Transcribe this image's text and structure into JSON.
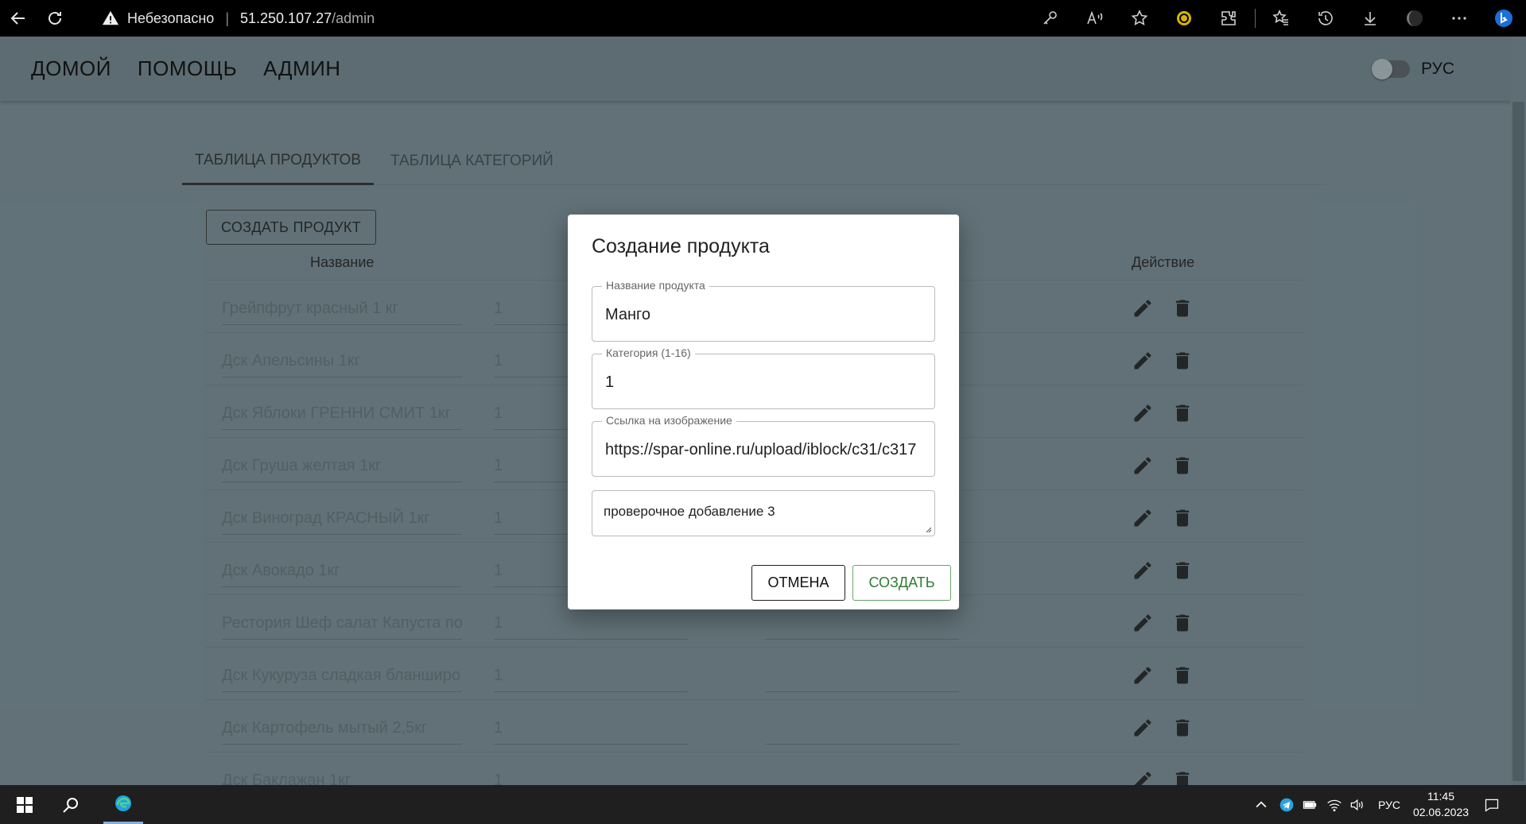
{
  "browser": {
    "security_label": "Небезопасно",
    "host": "51.250.107.27",
    "path": "/admin"
  },
  "app": {
    "nav": [
      "ДОМОЙ",
      "ПОМОЩЬ",
      "АДМИН"
    ],
    "language": "РУС"
  },
  "tabs": [
    "ТАБЛИЦА ПРОДУКТОВ",
    "ТАБЛИЦА КАТЕГОРИЙ"
  ],
  "create_button": "СОЗДАТЬ ПРОДУКТ",
  "table": {
    "headers": {
      "name": "Название",
      "action": "Действие"
    },
    "rows": [
      {
        "name": "Грейпфрут красный 1 кг",
        "category": "1"
      },
      {
        "name": "Дск Апельсины 1кг",
        "category": "1"
      },
      {
        "name": "Дск Яблоки ГРЕННИ СМИТ 1кг",
        "category": "1"
      },
      {
        "name": "Дск Груша желтая 1кг",
        "category": "1"
      },
      {
        "name": "Дск Виноград КРАСНЫЙ 1кг",
        "category": "1"
      },
      {
        "name": "Дск Авокадо 1кг",
        "category": "1"
      },
      {
        "name": "Рестория Шеф салат Капуста по",
        "category": "1"
      },
      {
        "name": "Дск Кукуруза сладкая бланширо",
        "category": "1"
      },
      {
        "name": "Дск Картофель мытый 2,5кг",
        "category": "1"
      },
      {
        "name": "Дск Баклажан 1кг",
        "category": "1"
      }
    ]
  },
  "modal": {
    "title": "Создание продукта",
    "fields": {
      "name_label": "Название продукта",
      "name_value": "Манго",
      "category_label": "Категория (1-16)",
      "category_value": "1",
      "image_label": "Ссылка на изображение",
      "image_value": "https://spar-online.ru/upload/iblock/c31/c317",
      "description_value": "проверочное добавление 3"
    },
    "cancel": "ОТМЕНА",
    "create": "СОЗДАТЬ"
  },
  "taskbar": {
    "tray_language": "РУС",
    "time": "11:45",
    "date": "02.06.2023"
  },
  "colors": {
    "page_bg": "#5c6c72",
    "create_green": "#2e7d32"
  }
}
